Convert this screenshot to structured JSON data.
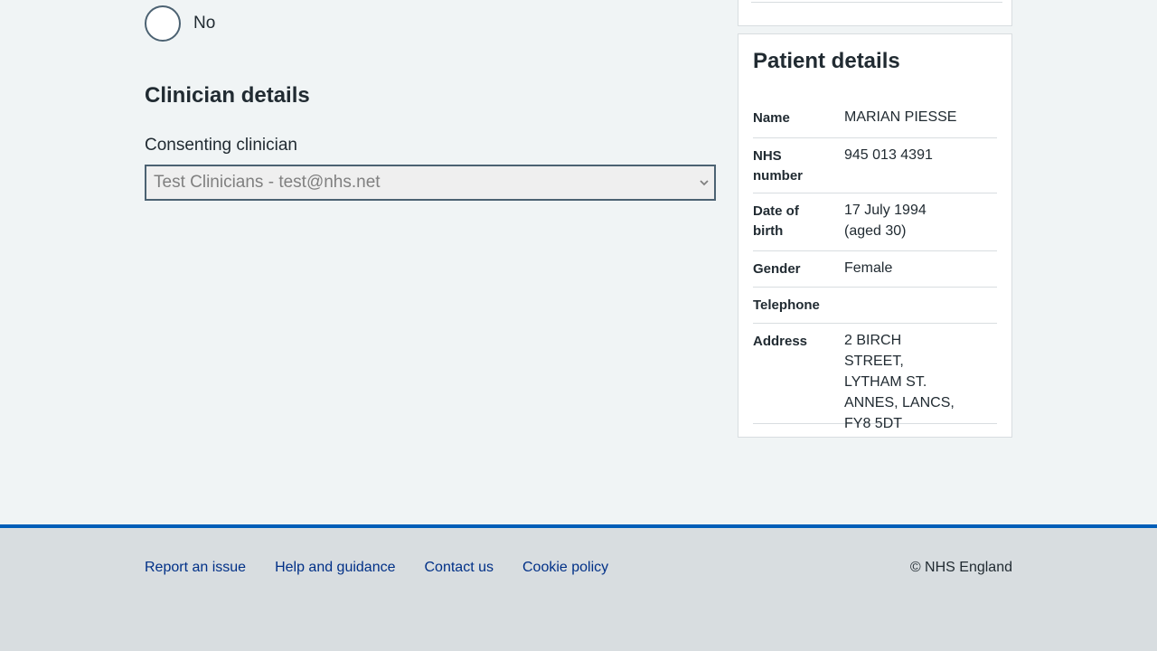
{
  "consent": {
    "no_label": "No"
  },
  "clinician": {
    "heading": "Clinician details",
    "consenting_label": "Consenting clinician",
    "selected_value": "Test Clinicians - test@nhs.net"
  },
  "patient": {
    "heading": "Patient details",
    "rows": [
      {
        "key": "Name",
        "value": "MARIAN PIESSE"
      },
      {
        "key": "NHS number",
        "value": "945 013 4391"
      },
      {
        "key": "Date of birth",
        "value": "17 July 1994 (aged 30)"
      },
      {
        "key": "Gender",
        "value": "Female"
      },
      {
        "key": "Telephone",
        "value": ""
      },
      {
        "key": "Address",
        "value": "2 BIRCH STREET, LYTHAM ST. ANNES, LANCS, FY8 5DT"
      }
    ]
  },
  "footer": {
    "links": [
      "Report an issue",
      "Help and guidance",
      "Contact us",
      "Cookie policy"
    ],
    "copyright": "© NHS England"
  },
  "colors": {
    "page_bg": "#f0f4f5",
    "footer_bg": "#d8dde0",
    "nhs_blue": "#005eb8",
    "link": "#003087",
    "text": "#212b32"
  }
}
